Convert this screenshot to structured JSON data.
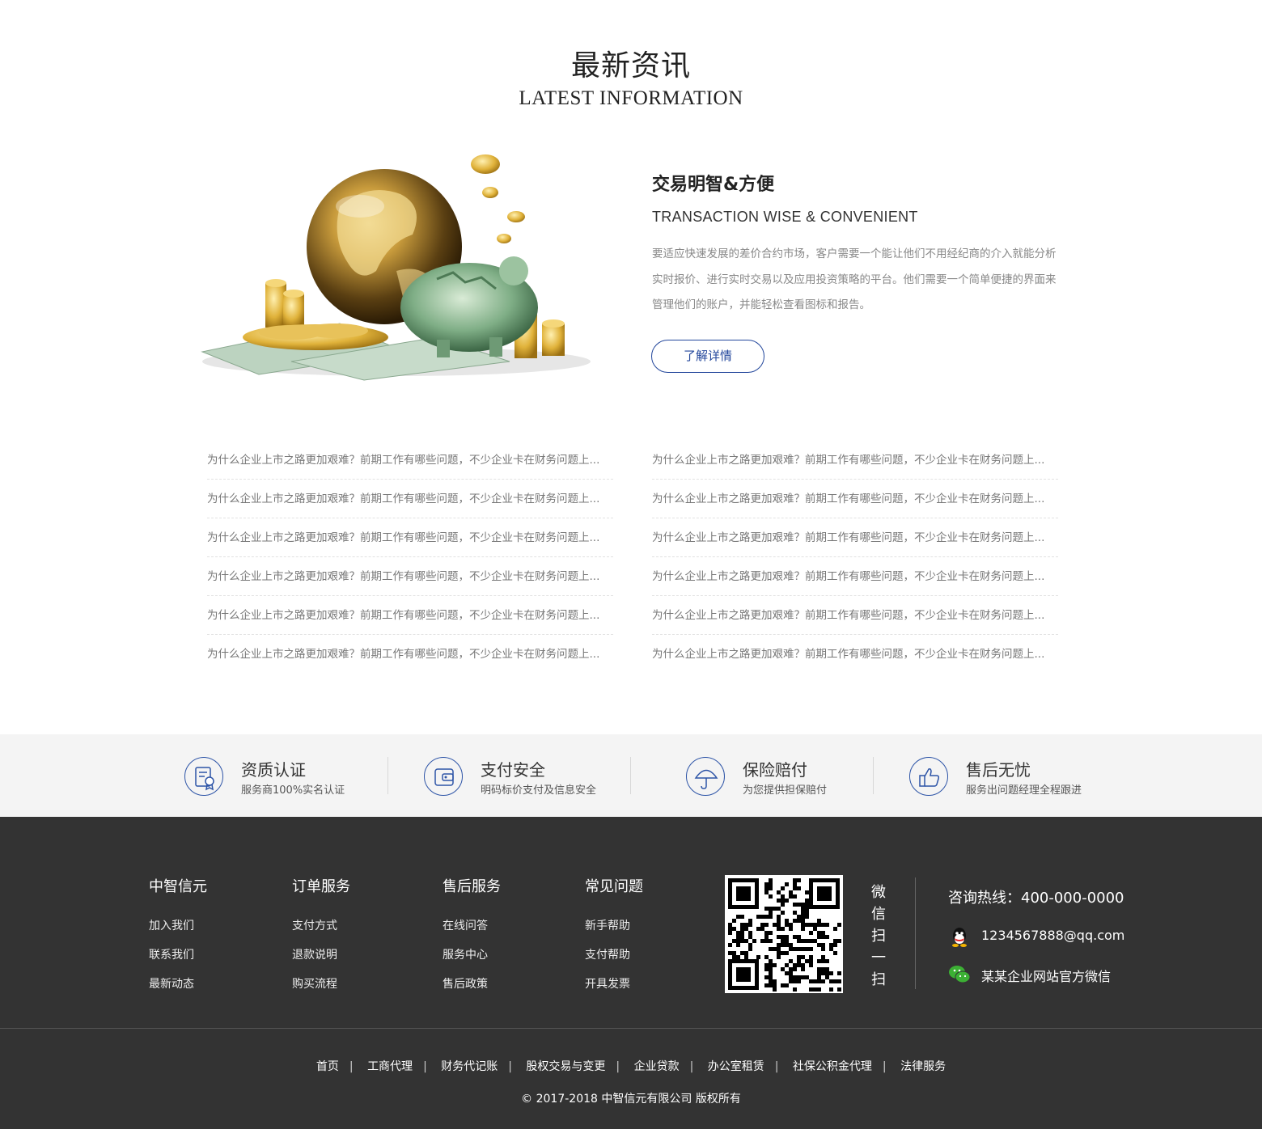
{
  "section": {
    "title_cn": "最新资讯",
    "title_en": "LATEST INFORMATION"
  },
  "hero_image": {
    "description_icon": "globe-coins-money-illustration"
  },
  "feature": {
    "title": "交易明智&方便",
    "subtitle": "TRANSACTION WISE & CONVENIENT",
    "body": "要适应快速发展的差价合约市场，客户需要一个能让他们不用经纪商的介入就能分析实时报价、进行实时交易以及应用投资策略的平台。他们需要一个简单便捷的界面来管理他们的账户，并能轻松查看图标和报告。",
    "button_label": "了解详情"
  },
  "news": {
    "left": [
      "为什么企业上市之路更加艰难？前期工作有哪些问题，不少企业卡在财务问题上...",
      "为什么企业上市之路更加艰难？前期工作有哪些问题，不少企业卡在财务问题上...",
      "为什么企业上市之路更加艰难？前期工作有哪些问题，不少企业卡在财务问题上...",
      "为什么企业上市之路更加艰难？前期工作有哪些问题，不少企业卡在财务问题上...",
      "为什么企业上市之路更加艰难？前期工作有哪些问题，不少企业卡在财务问题上...",
      "为什么企业上市之路更加艰难？前期工作有哪些问题，不少企业卡在财务问题上..."
    ],
    "right": [
      "为什么企业上市之路更加艰难？前期工作有哪些问题，不少企业卡在财务问题上...",
      "为什么企业上市之路更加艰难？前期工作有哪些问题，不少企业卡在财务问题上...",
      "为什么企业上市之路更加艰难？前期工作有哪些问题，不少企业卡在财务问题上...",
      "为什么企业上市之路更加艰难？前期工作有哪些问题，不少企业卡在财务问题上...",
      "为什么企业上市之路更加艰难？前期工作有哪些问题，不少企业卡在财务问题上...",
      "为什么企业上市之路更加艰难？前期工作有哪些问题，不少企业卡在财务问题上..."
    ]
  },
  "services": [
    {
      "name": "资质认证",
      "desc": "服务商100%实名认证",
      "icon": "certificate-icon"
    },
    {
      "name": "支付安全",
      "desc": "明码标价支付及信息安全",
      "icon": "wallet-icon"
    },
    {
      "name": "保险赔付",
      "desc": "为您提供担保赔付",
      "icon": "umbrella-icon"
    },
    {
      "name": "售后无忧",
      "desc": "服务出问题经理全程跟进",
      "icon": "thumbs-up-icon"
    }
  ],
  "footer": {
    "columns": [
      {
        "title": "中智信元",
        "links": [
          "加入我们",
          "联系我们",
          "最新动态"
        ]
      },
      {
        "title": "订单服务",
        "links": [
          "支付方式",
          "退款说明",
          "购买流程"
        ]
      },
      {
        "title": "售后服务",
        "links": [
          "在线问答",
          "服务中心",
          "售后政策"
        ]
      },
      {
        "title": "常见问题",
        "links": [
          "新手帮助",
          "支付帮助",
          "开具发票"
        ]
      }
    ],
    "qr_icon": "qr-code-icon",
    "wechat_scan": [
      "微",
      "信",
      "扫",
      "一",
      "扫"
    ],
    "hotline": "咨询热线：400-000-0000",
    "qq": {
      "icon": "qq-icon",
      "text": "1234567888@qq.com"
    },
    "wechat": {
      "icon": "wechat-icon",
      "text": "某某企业网站官方微信"
    },
    "bottom_links": [
      "首页",
      "工商代理",
      "财务代记账",
      "股权交易与变更",
      "企业贷款",
      "办公室租赁",
      "社保公积金代理",
      "法律服务"
    ],
    "copyright": "© 2017-2018 中智信元有限公司 版权所有"
  },
  "colors": {
    "accent": "#22469b",
    "footer_bg": "#333333",
    "service_bg": "#f4f4f4"
  }
}
